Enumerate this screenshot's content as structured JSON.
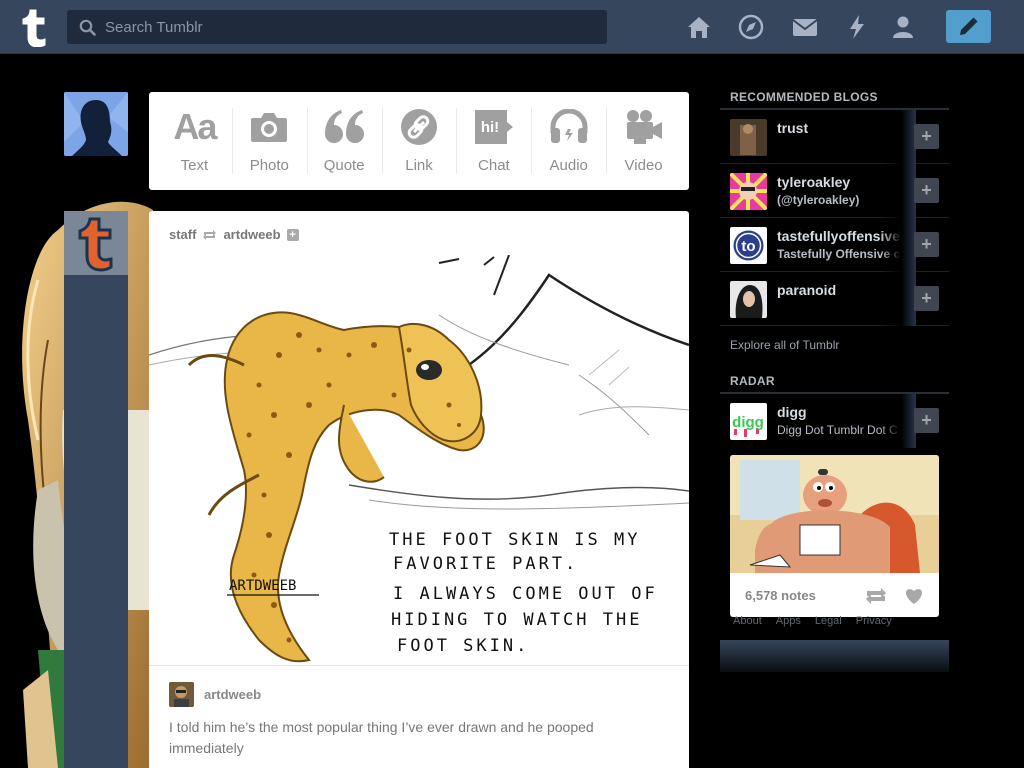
{
  "topbar": {
    "search_placeholder": "Search Tumblr",
    "nav_icons": [
      "home-icon",
      "explore-compass-icon",
      "inbox-envelope-icon",
      "activity-lightning-icon",
      "account-person-icon"
    ],
    "compose_icon": "pencil-icon",
    "accent_color": "#529ecc",
    "bar_color": "#36465d"
  },
  "post_types": [
    {
      "label": "Text",
      "icon": "text-aa-icon"
    },
    {
      "label": "Photo",
      "icon": "camera-icon"
    },
    {
      "label": "Quote",
      "icon": "quote-icon"
    },
    {
      "label": "Link",
      "icon": "link-icon"
    },
    {
      "label": "Chat",
      "icon": "chat-bubble-icon"
    },
    {
      "label": "Audio",
      "icon": "headphones-icon"
    },
    {
      "label": "Video",
      "icon": "video-camera-icon"
    }
  ],
  "post": {
    "reblogger": "staff",
    "source": "artdweeb",
    "signature": "ARTDWEEB",
    "handwriting": [
      "THE FOOT SKIN IS MY",
      "FAVORITE PART.",
      "I ALWAYS COME OUT OF",
      "HIDING TO WATCH THE",
      "FOOT SKIN."
    ],
    "author": "artdweeb",
    "caption": "I told him he’s the most popular thing I’ve ever drawn and he pooped immediately"
  },
  "sidebar": {
    "recommended_heading": "RECOMMENDED BLOGS",
    "blogs": [
      {
        "name": "trust",
        "subtitle": ""
      },
      {
        "name": "tyleroakley",
        "subtitle": "(@tyleroakley)"
      },
      {
        "name": "tastefullyoffensive",
        "subtitle": "Tastefully Offensive c"
      },
      {
        "name": "paranoid",
        "subtitle": ""
      }
    ],
    "follow_label": "+",
    "explore_label": "Explore all of Tumblr",
    "radar_heading": "RADAR",
    "radar": {
      "name": "digg",
      "subtitle": "Digg Dot Tumblr Dot C",
      "notes": "6,578 notes"
    },
    "footer_links": [
      "About",
      "Apps",
      "Legal",
      "Privacy"
    ]
  }
}
